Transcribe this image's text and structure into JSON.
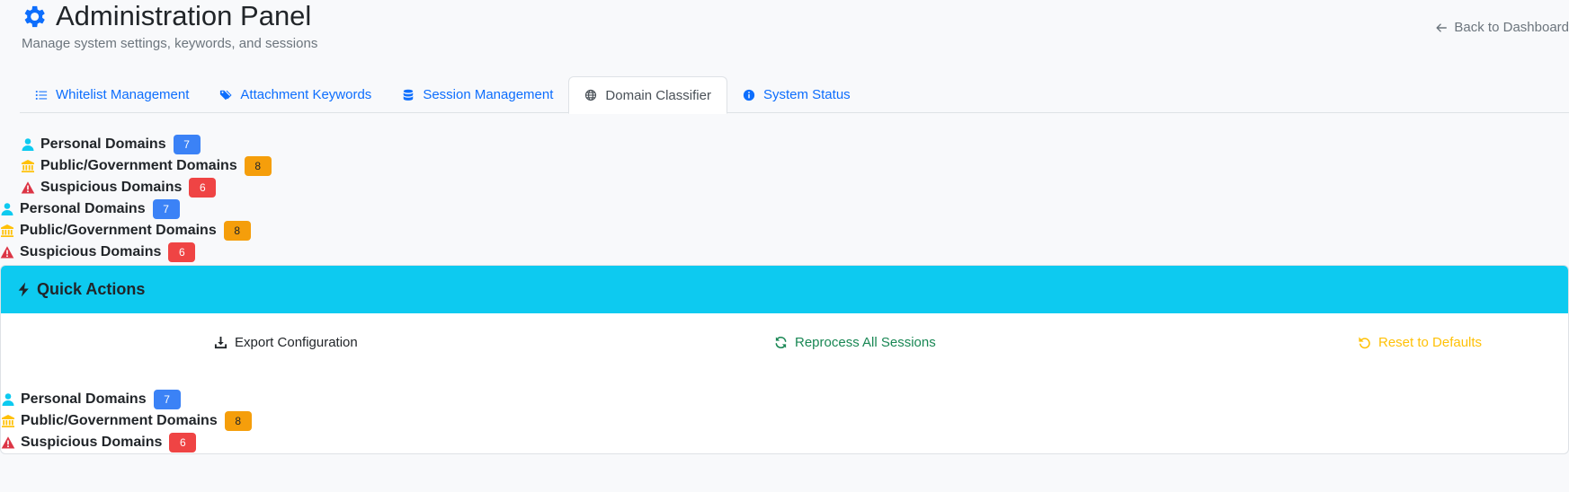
{
  "header": {
    "title": "Administration Panel",
    "subtitle": "Manage system settings, keywords, and sessions",
    "back_label": "Back to Dashboard"
  },
  "tabs": [
    {
      "label": "Whitelist Management",
      "icon": "list-icon"
    },
    {
      "label": "Attachment Keywords",
      "icon": "tags-icon"
    },
    {
      "label": "Session Management",
      "icon": "database-icon"
    },
    {
      "label": "Domain Classifier",
      "icon": "globe-icon",
      "active": true
    },
    {
      "label": "System Status",
      "icon": "info-circle-icon"
    }
  ],
  "domain_groups": [
    {
      "personal": {
        "label": "Personal Domains",
        "count": "7"
      },
      "public": {
        "label": "Public/Government Domains",
        "count": "8"
      },
      "suspicious": {
        "label": "Suspicious Domains",
        "count": "6"
      }
    },
    {
      "personal": {
        "label": "Personal Domains",
        "count": "7"
      },
      "public": {
        "label": "Public/Government Domains",
        "count": "8"
      },
      "suspicious": {
        "label": "Suspicious Domains",
        "count": "6"
      }
    },
    {
      "personal": {
        "label": "Personal Domains",
        "count": "7"
      },
      "public": {
        "label": "Public/Government Domains",
        "count": "8"
      },
      "suspicious": {
        "label": "Suspicious Domains",
        "count": "6"
      }
    }
  ],
  "quick_actions": {
    "title": "Quick Actions",
    "export_label": "Export Configuration",
    "reprocess_label": "Reprocess All Sessions",
    "reset_label": "Reset to Defaults"
  },
  "colors": {
    "primary": "#0d6efd",
    "info": "#0dcaf0",
    "success": "#198754",
    "warning": "#ffc107",
    "danger": "#dc3545"
  }
}
